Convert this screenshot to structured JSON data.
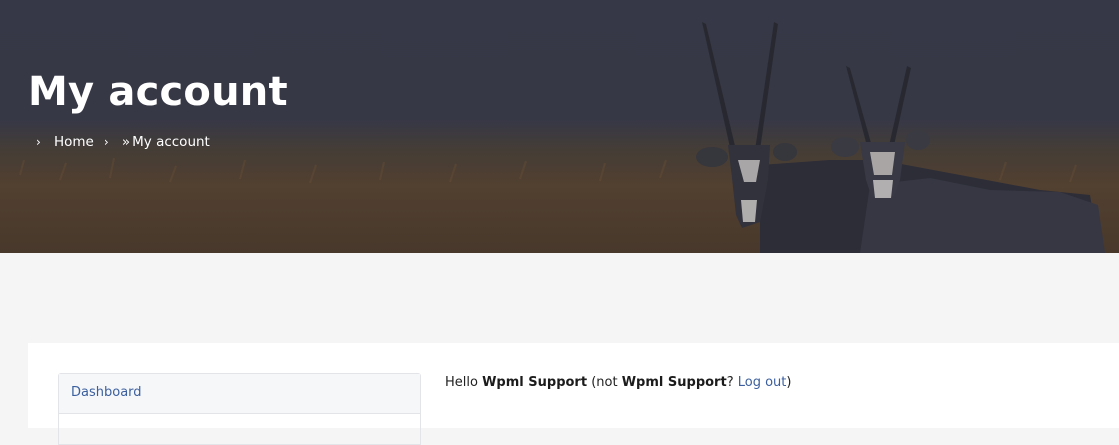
{
  "page": {
    "title": "My account"
  },
  "breadcrumb": {
    "home": "Home",
    "divider": "»",
    "current": "My account"
  },
  "account_nav": {
    "items": [
      {
        "label": "Dashboard"
      },
      {
        "label": ""
      }
    ]
  },
  "greeting": {
    "hello": "Hello",
    "user_name": "Wpml Support",
    "not_text": "(not",
    "not_user_name": "Wpml Support",
    "question": "?",
    "logout_label": "Log out",
    "close": ")"
  },
  "colors": {
    "hero_overlay": "#3b3d4b",
    "link": "#3b5f9e",
    "page_background": "#f5f5f5"
  }
}
